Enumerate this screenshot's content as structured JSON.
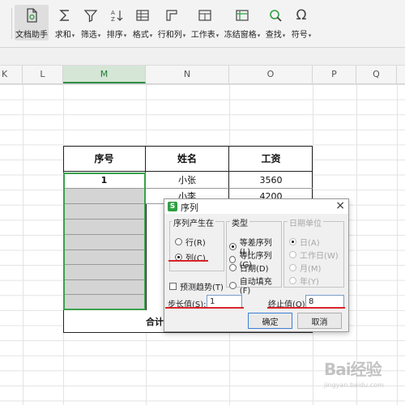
{
  "ribbon": {
    "items": [
      {
        "label": "文档助手",
        "caret": false,
        "icon": "document-assistant-icon"
      },
      {
        "label": "求和",
        "caret": true,
        "icon": "sigma-icon"
      },
      {
        "label": "筛选",
        "caret": true,
        "icon": "funnel-icon"
      },
      {
        "label": "排序",
        "caret": true,
        "icon": "sort-icon"
      },
      {
        "label": "格式",
        "caret": true,
        "icon": "format-icon"
      },
      {
        "label": "行和列",
        "caret": true,
        "icon": "rows-columns-icon"
      },
      {
        "label": "工作表",
        "caret": true,
        "icon": "worksheet-icon"
      },
      {
        "label": "冻结窗格",
        "caret": true,
        "icon": "freeze-panes-icon"
      },
      {
        "label": "查找",
        "caret": true,
        "icon": "magnifier-icon"
      },
      {
        "label": "符号",
        "caret": true,
        "icon": "omega-icon"
      }
    ],
    "caret": "▾"
  },
  "columns": [
    "K",
    "L",
    "M",
    "N",
    "O",
    "P",
    "Q"
  ],
  "selected_column": "M",
  "table": {
    "headers": [
      "序号",
      "姓名",
      "工资"
    ],
    "rows": [
      {
        "seq": "1",
        "name": "小张",
        "salary": "3560"
      },
      {
        "seq": "",
        "name": "小李",
        "salary": "4200"
      }
    ],
    "total_label": "合计"
  },
  "dialog": {
    "logo": "S",
    "title": "序列",
    "close": "×",
    "group_series_in": {
      "title": "序列产生在",
      "options": [
        {
          "label": "行(R)",
          "selected": false
        },
        {
          "label": "列(C)",
          "selected": true
        }
      ]
    },
    "group_type": {
      "title": "类型",
      "options": [
        {
          "label": "等差序列(L)",
          "selected": true
        },
        {
          "label": "等比序列(G)",
          "selected": false
        },
        {
          "label": "日期(D)",
          "selected": false
        },
        {
          "label": "自动填充(F)",
          "selected": false
        }
      ]
    },
    "group_date_unit": {
      "title": "日期单位",
      "options": [
        {
          "label": "日(A)",
          "selected": true
        },
        {
          "label": "工作日(W)",
          "selected": false
        },
        {
          "label": "月(M)",
          "selected": false
        },
        {
          "label": "年(Y)",
          "selected": false
        }
      ]
    },
    "trend_label": "预测趋势(T)",
    "step_label": "步长值(S):",
    "step_value": "1",
    "stop_label": "终止值(O):",
    "stop_value": "8",
    "ok": "确定",
    "cancel": "取消"
  },
  "watermark": {
    "text": "Bai经验",
    "sub": "jingyan.baidu.com"
  }
}
